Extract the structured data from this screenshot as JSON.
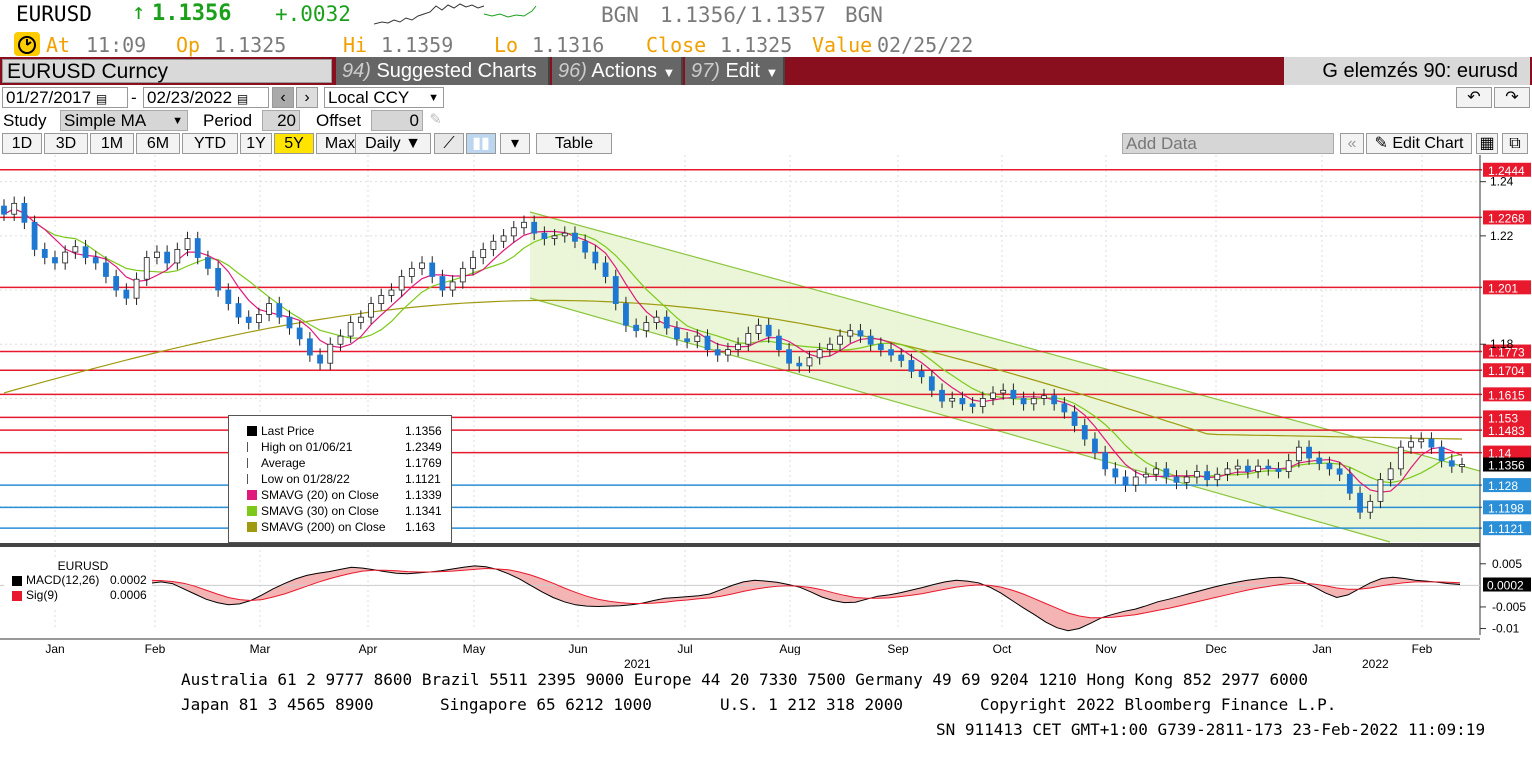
{
  "quote": {
    "ticker": "EURUSD",
    "arrow": "↑",
    "last": "1.1356",
    "change": "+.0032",
    "source": "BGN",
    "bid": "1.1356",
    "sep": "/",
    "ask": "1.1357",
    "source2": "BGN"
  },
  "stats": {
    "at_label": "At",
    "at": "11:09",
    "op_label": "Op",
    "op": "1.1325",
    "hi_label": "Hi",
    "hi": "1.1359",
    "lo_label": "Lo",
    "lo": "1.1316",
    "close_label": "Close",
    "close": "1.1325",
    "value_label": "Value",
    "value": "02/25/22"
  },
  "menubar": {
    "security": "EURUSD Curncy",
    "suggested_num": "94)",
    "suggested": "Suggested Charts",
    "actions_num": "96)",
    "actions": "Actions",
    "edit_num": "97)",
    "edit": "Edit",
    "title": "G elemzés 90: eurusd"
  },
  "controls": {
    "start_date": "01/27/2017",
    "dash": "-",
    "end_date": "02/23/2022",
    "currency": "Local CCY",
    "study_label": "Study",
    "study": "Simple MA",
    "period_label": "Period",
    "period": "20",
    "offset_label": "Offset",
    "offset": "0",
    "ranges": [
      "1D",
      "3D",
      "1M",
      "6M",
      "YTD",
      "1Y",
      "5Y",
      "Max"
    ],
    "active_range": "5Y",
    "frequency": "Daily ▼",
    "table": "Table",
    "add_data": "Add Data",
    "edit_chart": "Edit Chart"
  },
  "legend": {
    "items": [
      {
        "label": "Last Price",
        "value": "1.1356",
        "color": "#000000"
      },
      {
        "label": "High on 01/06/21",
        "value": "1.2349",
        "color": ""
      },
      {
        "label": "Average",
        "value": "1.1769",
        "color": ""
      },
      {
        "label": "Low on 01/28/22",
        "value": "1.1121",
        "color": ""
      },
      {
        "label": "SMAVG (20)  on Close",
        "value": "1.1339",
        "color": "#e0197d"
      },
      {
        "label": "SMAVG (30)  on Close",
        "value": "1.1341",
        "color": "#7dc91a"
      },
      {
        "label": "SMAVG (200)  on Close",
        "value": "1.163",
        "color": "#a09a10"
      }
    ]
  },
  "macd_legend": {
    "title": "EURUSD",
    "macd_label": "MACD(12,26)",
    "macd_value": "0.0002",
    "sig_label": "Sig(9)",
    "sig_value": "0.0006"
  },
  "chart_data": {
    "type": "candlestick",
    "instrument": "EURUSD",
    "x_months": [
      "Jan",
      "Feb",
      "Mar",
      "Apr",
      "May",
      "Jun",
      "Jul",
      "Aug",
      "Sep",
      "Oct",
      "Nov",
      "Dec",
      "Jan",
      "Feb"
    ],
    "year_labels": [
      "2021",
      "2022"
    ],
    "price_axis_ticks": [
      "1.24",
      "1.22",
      "1.18"
    ],
    "ylim": [
      1.107,
      1.248
    ],
    "horizontal_levels": [
      {
        "value": 1.2444,
        "label": "1.2444",
        "color": "#e8192c"
      },
      {
        "value": 1.2268,
        "label": "1.2268",
        "color": "#e8192c"
      },
      {
        "value": 1.201,
        "label": "1.201",
        "color": "#e8192c"
      },
      {
        "value": 1.1773,
        "label": "1.1773",
        "color": "#e8192c"
      },
      {
        "value": 1.1704,
        "label": "1.1704",
        "color": "#e8192c"
      },
      {
        "value": 1.1615,
        "label": "1.1615",
        "color": "#e8192c"
      },
      {
        "value": 1.153,
        "label": "1.153",
        "color": "#e8192c"
      },
      {
        "value": 1.1483,
        "label": "1.1483",
        "color": "#e8192c"
      },
      {
        "value": 1.14,
        "label": "1.14",
        "color": "#e8192c"
      },
      {
        "value": 1.128,
        "label": "1.128",
        "color": "#2a8fd6"
      },
      {
        "value": 1.1198,
        "label": "1.1198",
        "color": "#2a8fd6"
      },
      {
        "value": 1.1121,
        "label": "1.1121",
        "color": "#2a8fd6"
      }
    ],
    "last_price_tag": "1.1356",
    "close_series": [
      1.228,
      1.232,
      1.225,
      1.215,
      1.212,
      1.21,
      1.214,
      1.216,
      1.212,
      1.21,
      1.205,
      1.2,
      1.197,
      1.204,
      1.212,
      1.214,
      1.21,
      1.215,
      1.219,
      1.212,
      1.208,
      1.2,
      1.195,
      1.19,
      1.188,
      1.191,
      1.195,
      1.19,
      1.186,
      1.182,
      1.176,
      1.173,
      1.18,
      1.183,
      1.188,
      1.19,
      1.195,
      1.198,
      1.2,
      1.205,
      1.208,
      1.21,
      1.205,
      1.2,
      1.203,
      1.208,
      1.212,
      1.215,
      1.218,
      1.22,
      1.223,
      1.225,
      1.221,
      1.219,
      1.22,
      1.221,
      1.218,
      1.214,
      1.21,
      1.205,
      1.195,
      1.187,
      1.185,
      1.188,
      1.19,
      1.186,
      1.182,
      1.181,
      1.183,
      1.178,
      1.176,
      1.178,
      1.18,
      1.184,
      1.187,
      1.183,
      1.178,
      1.173,
      1.172,
      1.175,
      1.178,
      1.18,
      1.183,
      1.185,
      1.183,
      1.18,
      1.178,
      1.176,
      1.174,
      1.17,
      1.168,
      1.163,
      1.159,
      1.16,
      1.158,
      1.157,
      1.16,
      1.162,
      1.163,
      1.16,
      1.158,
      1.16,
      1.161,
      1.158,
      1.155,
      1.15,
      1.145,
      1.14,
      1.134,
      1.131,
      1.128,
      1.131,
      1.132,
      1.134,
      1.131,
      1.129,
      1.131,
      1.133,
      1.13,
      1.132,
      1.134,
      1.135,
      1.133,
      1.135,
      1.134,
      1.133,
      1.137,
      1.142,
      1.138,
      1.136,
      1.134,
      1.132,
      1.125,
      1.118,
      1.122,
      1.13,
      1.134,
      1.142,
      1.144,
      1.145,
      1.142,
      1.137,
      1.135,
      1.1356
    ],
    "macd_axis_ticks": [
      "0.005",
      "0",
      "-0.005",
      "-0.01"
    ],
    "macd_ylim": [
      -0.0115,
      0.0075
    ],
    "macd_last_tag": "0.0002",
    "macd": [
      0.0005,
      0.0008,
      0.0004,
      -0.0008,
      -0.002,
      -0.0032,
      -0.004,
      -0.0045,
      -0.0043,
      -0.0035,
      -0.0022,
      -0.0008,
      0.0004,
      0.0015,
      0.0023,
      0.0028,
      0.0032,
      0.0037,
      0.0042,
      0.004,
      0.0036,
      0.0032,
      0.0028,
      0.0027,
      0.0029,
      0.0031,
      0.0034,
      0.0038,
      0.0042,
      0.0045,
      0.0043,
      0.0037,
      0.0027,
      0.0015,
      0.0,
      -0.0015,
      -0.0028,
      -0.0038,
      -0.0045,
      -0.0048,
      -0.0049,
      -0.0048,
      -0.0047,
      -0.0045,
      -0.0041,
      -0.0035,
      -0.003,
      -0.0028,
      -0.0026,
      -0.0024,
      -0.002,
      -0.001,
      0.0,
      0.0008,
      0.0012,
      0.001,
      0.0007,
      0.0002,
      -0.0004,
      -0.0015,
      -0.0027,
      -0.0035,
      -0.004,
      -0.0039,
      -0.0032,
      -0.0025,
      -0.0022,
      -0.0017,
      -0.0011,
      -0.0005,
      0.0002,
      0.0008,
      0.0012,
      0.001,
      0.0006,
      -0.0004,
      -0.0018,
      -0.0035,
      -0.0052,
      -0.0068,
      -0.0085,
      -0.0098,
      -0.0105,
      -0.01,
      -0.0088,
      -0.0075,
      -0.0067,
      -0.006,
      -0.0055,
      -0.0047,
      -0.0038,
      -0.0032,
      -0.0025,
      -0.0018,
      -0.0011,
      -0.0004,
      0.0002,
      0.0007,
      0.0012,
      0.0015,
      0.0018,
      0.0019,
      0.0016,
      0.0008,
      -0.0004,
      -0.0018,
      -0.0028,
      -0.0022,
      -0.0008,
      0.0006,
      0.0016,
      0.0019,
      0.0016,
      0.0012,
      0.001,
      0.0007,
      0.0004,
      0.0002
    ],
    "signal": [
      0.0012,
      0.0011,
      0.0009,
      0.0005,
      -0.0002,
      -0.0011,
      -0.002,
      -0.0028,
      -0.0033,
      -0.0035,
      -0.0033,
      -0.0027,
      -0.002,
      -0.0011,
      -0.0002,
      0.0007,
      0.0015,
      0.0022,
      0.0028,
      0.0033,
      0.0035,
      0.0035,
      0.0034,
      0.0032,
      0.0031,
      0.0031,
      0.0032,
      0.0033,
      0.0035,
      0.0037,
      0.0039,
      0.0038,
      0.0036,
      0.0031,
      0.0024,
      0.0015,
      0.0005,
      -0.0006,
      -0.0016,
      -0.0025,
      -0.0032,
      -0.0037,
      -0.004,
      -0.0042,
      -0.0042,
      -0.0041,
      -0.0039,
      -0.0036,
      -0.0034,
      -0.0031,
      -0.0029,
      -0.0025,
      -0.002,
      -0.0014,
      -0.0009,
      -0.0005,
      -0.0002,
      -0.0001,
      -0.0002,
      -0.0005,
      -0.001,
      -0.0017,
      -0.0023,
      -0.0028,
      -0.003,
      -0.003,
      -0.0029,
      -0.0026,
      -0.0023,
      -0.0019,
      -0.0014,
      -0.0009,
      -0.0004,
      -0.0001,
      0.0001,
      0.0,
      -0.0004,
      -0.0011,
      -0.002,
      -0.0031,
      -0.0042,
      -0.0053,
      -0.0064,
      -0.0071,
      -0.0075,
      -0.0075,
      -0.0074,
      -0.0071,
      -0.0068,
      -0.0063,
      -0.0058,
      -0.0053,
      -0.0047,
      -0.0041,
      -0.0035,
      -0.0029,
      -0.0023,
      -0.0017,
      -0.0011,
      -0.0006,
      -0.0002,
      0.0002,
      0.0005,
      0.0005,
      0.0003,
      -0.0001,
      -0.0006,
      -0.0009,
      -0.0009,
      -0.0006,
      -0.0001,
      0.0003,
      0.0006,
      0.0008,
      0.0008,
      0.0008,
      0.0007,
      0.0006
    ]
  },
  "footer": {
    "line1": "Australia 61 2 9777 8600 Brazil 5511 2395 9000 Europe 44 20 7330 7500 Germany 49 69 9204 1210 Hong Kong 852 2977 6000",
    "line2a": "Japan 81 3 4565 8900",
    "line2b": "Singapore 65 6212 1000",
    "line2c": "U.S. 1 212 318 2000",
    "line2d": "Copyright 2022 Bloomberg Finance L.P.",
    "line3": "SN 911413 CET  GMT+1:00 G739-2811-173 23-Feb-2022 11:09:19"
  }
}
